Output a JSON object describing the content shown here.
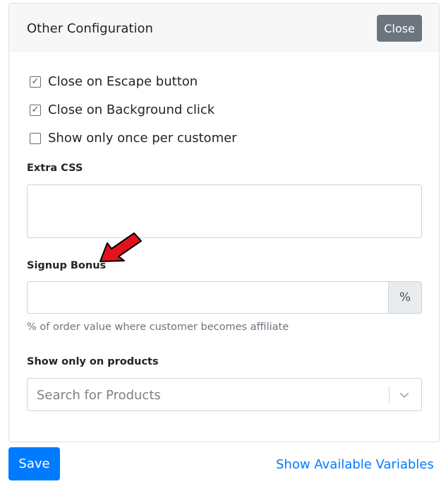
{
  "card": {
    "title": "Other Configuration",
    "close_label": "Close"
  },
  "options": [
    {
      "label": "Close on Escape button",
      "checked": true
    },
    {
      "label": "Close on Background click",
      "checked": true
    },
    {
      "label": "Show only once per customer",
      "checked": false
    }
  ],
  "extra_css": {
    "label": "Extra CSS",
    "value": ""
  },
  "signup_bonus": {
    "label": "Signup Bonus",
    "value": "",
    "unit": "%",
    "help": "% of order value where customer becomes affiliate"
  },
  "products": {
    "label": "Show only on products",
    "placeholder": "Search for Products"
  },
  "footer": {
    "save_label": "Save",
    "variables_link": "Show Available Variables"
  },
  "colors": {
    "primary": "#007bff",
    "secondary": "#6c757d",
    "annotation_arrow": "#e3131b"
  },
  "icons": {
    "checkbox_checked": "check-icon",
    "select_toggle": "chevron-down-icon",
    "annotation": "arrow-icon"
  }
}
